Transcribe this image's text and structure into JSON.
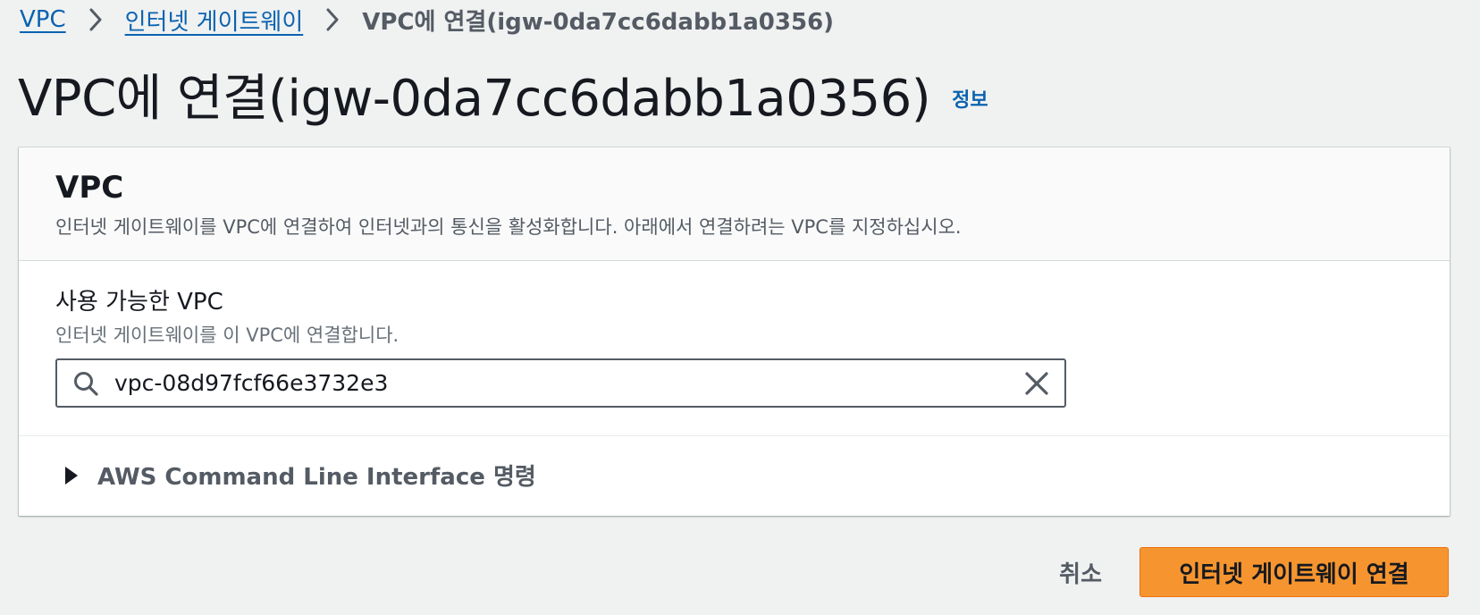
{
  "breadcrumb": {
    "items": [
      {
        "label": "VPC"
      },
      {
        "label": "인터넷 게이트웨이"
      }
    ],
    "current": "VPC에 연결(igw-0da7cc6dabb1a0356)"
  },
  "page": {
    "title": "VPC에 연결(igw-0da7cc6dabb1a0356)",
    "info_link": "정보"
  },
  "panel": {
    "title": "VPC",
    "description": "인터넷 게이트웨이를 VPC에 연결하여 인터넷과의 통신을 활성화합니다. 아래에서 연결하려는 VPC를 지정하십시오.",
    "field": {
      "label": "사용 가능한 VPC",
      "description": "인터넷 게이트웨이를 이 VPC에 연결합니다.",
      "value": "vpc-08d97fcf66e3732e3"
    },
    "cli_expander": {
      "label": "AWS Command Line Interface 명령",
      "expanded": false
    }
  },
  "actions": {
    "cancel_label": "취소",
    "submit_label": "인터넷 게이트웨이 연결"
  },
  "colors": {
    "link": "#0a63b0",
    "primary_button": "#f6952f",
    "background": "#f0f1f1"
  }
}
